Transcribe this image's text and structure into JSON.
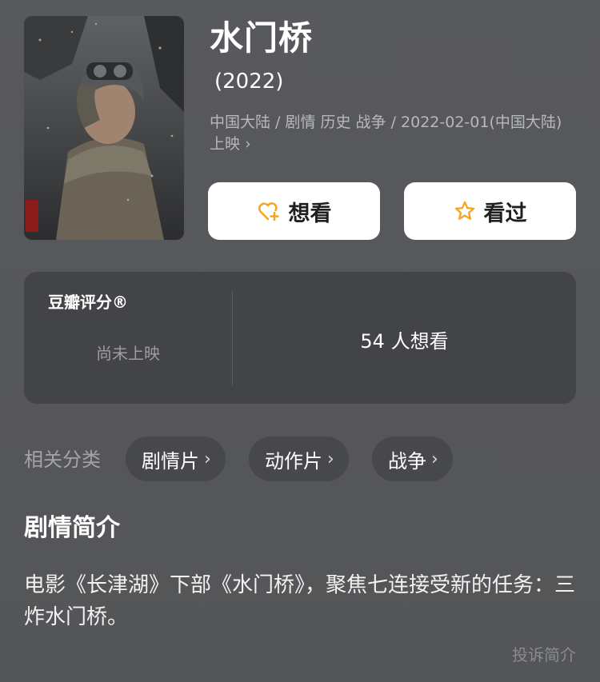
{
  "movie": {
    "title": "水门桥",
    "year": "(2022)",
    "meta": "中国大陆 / 剧情 历史 战争 / 2022-02-01(中国大陆) 上映",
    "meta_chevron": "›"
  },
  "actions": {
    "want_label": "想看",
    "seen_label": "看过"
  },
  "rating": {
    "label": "豆瓣评分®",
    "status": "尚未上映",
    "wish_count": "54 人想看"
  },
  "categories": {
    "label": "相关分类",
    "chips": [
      {
        "label": "剧情片",
        "chevron": "›"
      },
      {
        "label": "动作片",
        "chevron": "›"
      },
      {
        "label": "战争",
        "chevron": "›"
      }
    ]
  },
  "synopsis": {
    "heading": "剧情简介",
    "text": "电影《长津湖》下部《水门桥》，聚焦七连接受新的任务：三炸水门桥。",
    "report_label": "投诉简介"
  },
  "colors": {
    "background": "#58595c",
    "card": "#434447",
    "accent_orange": "#f5a623",
    "button_bg": "#ffffff"
  },
  "icons": {
    "want": "heart-plus-icon",
    "seen": "star-icon"
  }
}
